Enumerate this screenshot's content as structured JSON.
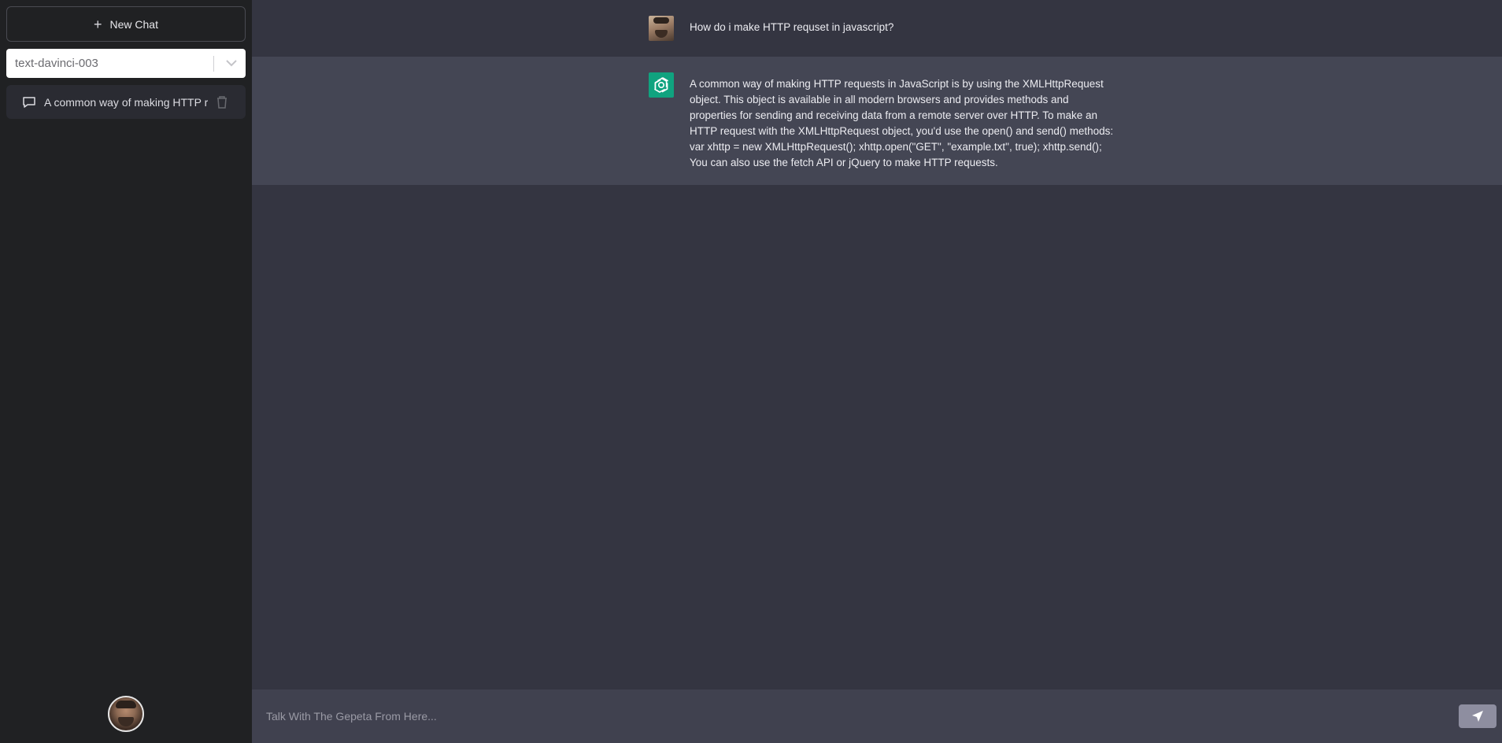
{
  "sidebar": {
    "new_chat_label": "New Chat",
    "model_select": {
      "selected": "text-davinci-003"
    },
    "history": [
      {
        "label": "A common way of making HTTP requests in JavaScript is by using the XMLHttpRequest object."
      }
    ]
  },
  "conversation": {
    "messages": [
      {
        "role": "user",
        "text": "How do i make HTTP requset in javascript?"
      },
      {
        "role": "assistant",
        "text": "A common way of making HTTP requests in JavaScript is by using the XMLHttpRequest object. This object is available in all modern browsers and provides methods and properties for sending and receiving data from a remote server over HTTP. To make an HTTP request with the XMLHttpRequest object, you'd use the open() and send() methods: var xhttp = new XMLHttpRequest(); xhttp.open(\"GET\", \"example.txt\", true); xhttp.send(); You can also use the fetch API or jQuery to make HTTP requests."
      }
    ]
  },
  "input": {
    "placeholder": "Talk With The Gepeta From Here...",
    "value": ""
  },
  "icons": {
    "new_chat": "plus-icon",
    "model_dropdown": "chevron-down-icon",
    "history_item": "chat-bubble-icon",
    "delete": "trash-icon",
    "assistant_avatar": "openai-logo-icon",
    "send": "send-icon"
  },
  "colors": {
    "sidebar_bg": "#202123",
    "main_bg": "#343541",
    "assistant_row_bg": "#444654",
    "input_bg": "#40414f",
    "accent": "#10a37f",
    "send_button": "#8e8ea0"
  }
}
